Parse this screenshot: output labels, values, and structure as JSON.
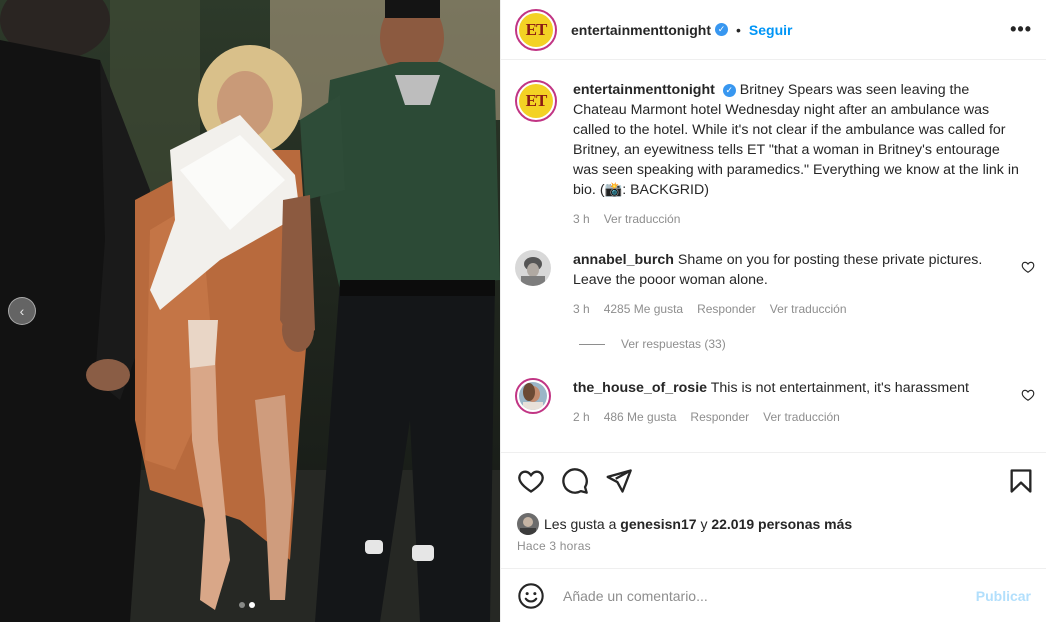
{
  "post": {
    "username": "entertainmenttonight",
    "follow_label": "Seguir",
    "separator": "•",
    "more_label": "•••"
  },
  "caption": {
    "username": "entertainmenttonight",
    "text": "Britney Spears was seen leaving the Chateau Marmont hotel Wednesday night after an ambulance was called to the hotel. While it's not clear if the ambulance was called for Britney, an eyewitness tells ET \"that a woman in Britney's entourage was seen speaking with paramedics.\" Everything we know at the link in bio. (📸: BACKGRID)",
    "time": "3 h",
    "translate": "Ver traducción"
  },
  "comments": [
    {
      "username": "annabel_burch",
      "text": "Shame on you for posting these private pictures. Leave the pooor woman alone.",
      "time": "3 h",
      "likes": "4285 Me gusta",
      "reply": "Responder",
      "translate": "Ver traducción"
    },
    {
      "username": "the_house_of_rosie",
      "text": "This is not entertainment, it's harassment",
      "time": "2 h",
      "likes": "486 Me gusta",
      "reply": "Responder",
      "translate": "Ver traducción"
    }
  ],
  "replies_label": "Ver respuestas (33)",
  "likes_line": {
    "prefix": "Les gusta a",
    "user": "genesisn17",
    "mid": "y",
    "count": "22.019 personas más"
  },
  "posted_time": "Hace 3 horas",
  "logo_text": "ET",
  "add_comment": {
    "placeholder": "Añade un comentario...",
    "publish_label": "Publicar"
  },
  "icons": {
    "like": "heart-icon",
    "comment": "comment-bubble-icon",
    "share": "paper-plane-icon",
    "save": "bookmark-icon",
    "emoji": "emoji-icon",
    "verified": "verified-badge-icon",
    "prev": "chevron-left-icon"
  },
  "colors": {
    "accent_blue": "#0095f6",
    "publish_disabled": "#b2dffc",
    "muted": "#8e8e8e",
    "et_yellow": "#f3d224"
  }
}
